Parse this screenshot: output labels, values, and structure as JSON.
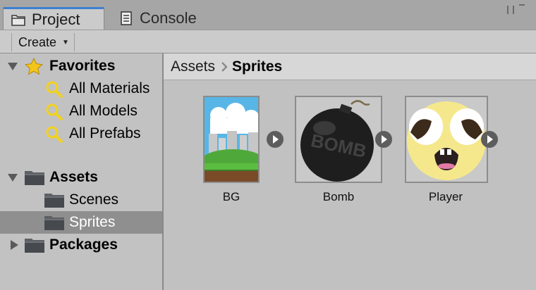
{
  "tabs": [
    {
      "label": "Project",
      "icon": "folder-icon",
      "active": true
    },
    {
      "label": "Console",
      "icon": "console-icon",
      "active": false
    }
  ],
  "toolbar": {
    "create_label": "Create",
    "create_arrow": "▼"
  },
  "sidebar": {
    "favorites": {
      "label": "Favorites",
      "items": [
        {
          "label": "All Materials",
          "icon": "search-icon"
        },
        {
          "label": "All Models",
          "icon": "search-icon"
        },
        {
          "label": "All Prefabs",
          "icon": "search-icon"
        }
      ]
    },
    "assets": {
      "label": "Assets",
      "children": [
        {
          "label": "Scenes",
          "icon": "folder-icon",
          "selected": false
        },
        {
          "label": "Sprites",
          "icon": "folder-icon",
          "selected": true
        }
      ]
    },
    "packages": {
      "label": "Packages"
    }
  },
  "breadcrumb": {
    "root": "Assets",
    "current": "Sprites"
  },
  "grid": {
    "items": [
      {
        "label": "BG",
        "thumbnail": "background-sprite-thumbnail"
      },
      {
        "label": "Bomb",
        "thumbnail": "bomb-sprite-thumbnail",
        "thumbnail_text": "BOMB"
      },
      {
        "label": "Player",
        "thumbnail": "player-face-sprite-thumbnail"
      }
    ]
  },
  "colors": {
    "accent": "#3d7fd1",
    "selection": "#8f8f8f",
    "star": "#f4c51a",
    "search_lens": "#f2d21b"
  }
}
